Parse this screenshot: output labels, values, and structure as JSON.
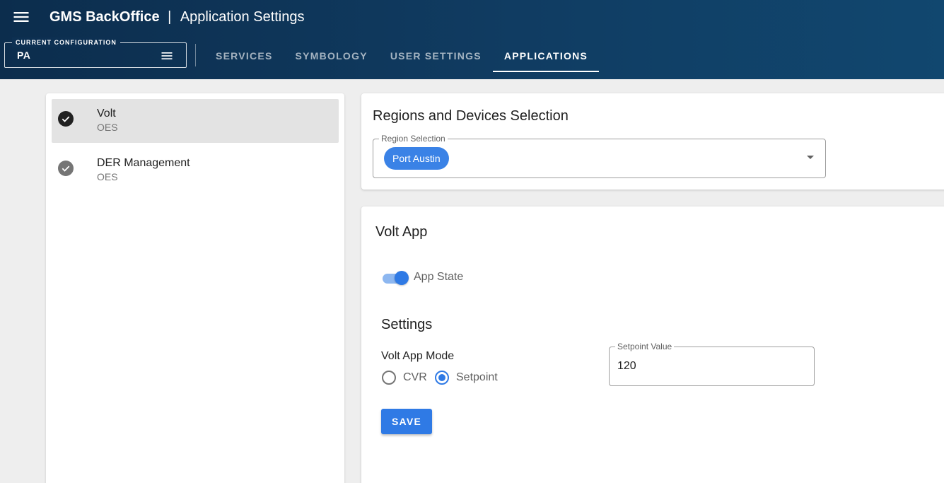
{
  "header": {
    "brand": "GMS BackOffice",
    "separator": "|",
    "page_title": "Application Settings",
    "config_legend": "CURRENT CONFIGURATION",
    "config_value": "PA",
    "tabs": [
      {
        "label": "SERVICES",
        "active": false
      },
      {
        "label": "SYMBOLOGY",
        "active": false
      },
      {
        "label": "USER SETTINGS",
        "active": false
      },
      {
        "label": "APPLICATIONS",
        "active": true
      }
    ]
  },
  "app_list": {
    "items": [
      {
        "title": "Volt",
        "subtitle": "OES",
        "selected": true,
        "check_color": "#212121"
      },
      {
        "title": "DER Management",
        "subtitle": "OES",
        "selected": false,
        "check_color": "#757575"
      }
    ]
  },
  "regions": {
    "title": "Regions and Devices Selection",
    "field_label": "Region Selection",
    "chips": [
      "Port Austin"
    ]
  },
  "volt_app": {
    "title": "Volt App",
    "app_state_label": "App State",
    "app_state_on": true,
    "settings_title": "Settings",
    "mode_label": "Volt App Mode",
    "mode_options": [
      {
        "label": "CVR",
        "checked": false
      },
      {
        "label": "Setpoint",
        "checked": true
      }
    ],
    "setpoint_label": "Setpoint Value",
    "setpoint_value": "120",
    "save_label": "SAVE"
  },
  "colors": {
    "header_bg": "#103c62",
    "accent": "#2f7ae5"
  }
}
